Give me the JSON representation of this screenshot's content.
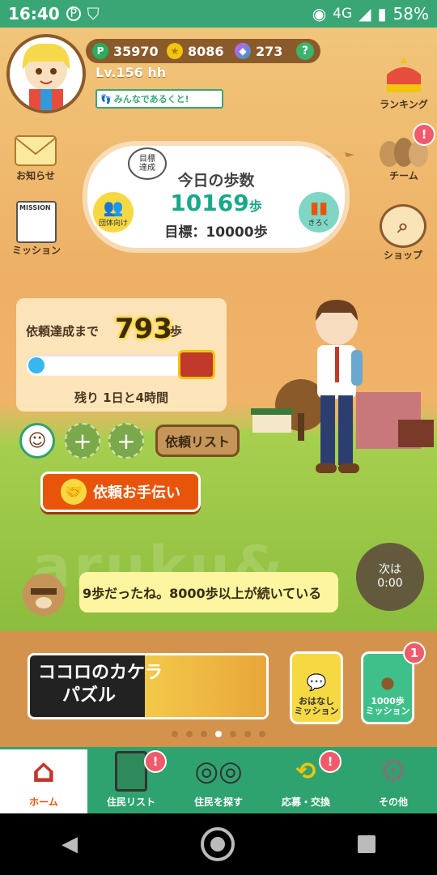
{
  "status_bar": {
    "time": "16:40",
    "network": "4G",
    "battery": "58%"
  },
  "header": {
    "points": "35970",
    "coins": "8086",
    "gems": "273",
    "level": "Lv.156 hh",
    "walk_banner": "みんなであるくと!"
  },
  "left_menu": [
    {
      "label": "お知らせ",
      "icon": "mail-icon"
    },
    {
      "label": "ミッション",
      "icon": "mission-card-icon",
      "icon_text": "MISSION"
    }
  ],
  "right_menu": [
    {
      "label": "ランキング",
      "icon": "crown-icon"
    },
    {
      "label": "チーム",
      "icon": "team-icon",
      "badge": "!"
    },
    {
      "label": "ショップ",
      "icon": "shop-magnifier-icon"
    }
  ],
  "step_cloud": {
    "tag": "目標\n達成",
    "title": "今日の歩数",
    "steps": "10169",
    "steps_unit": "歩",
    "goal": "目標：10000歩",
    "group_label": "団体向け",
    "record_label": "きろく"
  },
  "request": {
    "label": "依頼達成まで",
    "remaining_steps": "793",
    "unit": "歩",
    "progress": 0.1,
    "time_left": "残り 1日と4時間"
  },
  "party": {
    "list_button": "依頼リスト",
    "add_slot": "+"
  },
  "help_button": "依頼お手伝い",
  "speech": "9歩だったね。8000歩以上が続いている",
  "omikuji": {
    "line1": "次は",
    "line2": "0:00"
  },
  "banner": {
    "line1": "ココロのカケラ",
    "line2": "パズル"
  },
  "missions": [
    {
      "label": "おはなし\nミッション"
    },
    {
      "label": "1000歩\nミッション",
      "badge": "1"
    }
  ],
  "pager": {
    "count": 7,
    "active": 3
  },
  "tabs": [
    {
      "label": "ホーム",
      "icon": "house-icon",
      "active": true
    },
    {
      "label": "住民リスト",
      "icon": "resident-list-icon",
      "badge": "!"
    },
    {
      "label": "住民を探す",
      "icon": "binoculars-icon"
    },
    {
      "label": "応募・交換",
      "icon": "exchange-icon",
      "badge": "!"
    },
    {
      "label": "その他",
      "icon": "gear-icon"
    }
  ],
  "colors": {
    "accent": "#e8550a",
    "green": "#2fa36f",
    "steps": "#1aa88a"
  }
}
